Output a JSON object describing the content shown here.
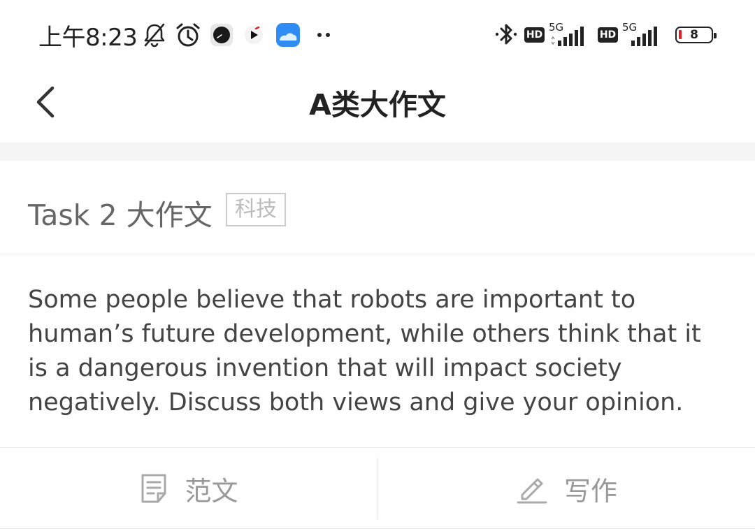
{
  "status_bar": {
    "time": "上午8:23",
    "icons_left": [
      "bell-off-icon",
      "alarm-icon",
      "app-clock-icon",
      "app-video-icon",
      "app-cloud-icon",
      "more-dots-icon"
    ],
    "icons_right": [
      "bluetooth-icon",
      "hd-badge",
      "signal-5g-icon",
      "hd-badge",
      "signal-5g-icon",
      "battery-icon"
    ],
    "hd_label": "HD",
    "network_label_1": "5G",
    "network_label_2": "5G",
    "battery_percent": "8",
    "battery_low_color": "#e02020"
  },
  "nav": {
    "back_icon": "chevron-left-icon",
    "title": "A类大作文"
  },
  "task": {
    "title": "Task 2 大作文",
    "tag": "科技"
  },
  "prompt": {
    "text": "Some people believe that robots are important to human’s future development, while others think that it is a dangerous invention that will impact society negatively. Discuss both views and give your opinion."
  },
  "bottom_bar": {
    "sample_icon": "note-icon",
    "sample_label": "范文",
    "write_icon": "pencil-icon",
    "write_label": "写作"
  }
}
